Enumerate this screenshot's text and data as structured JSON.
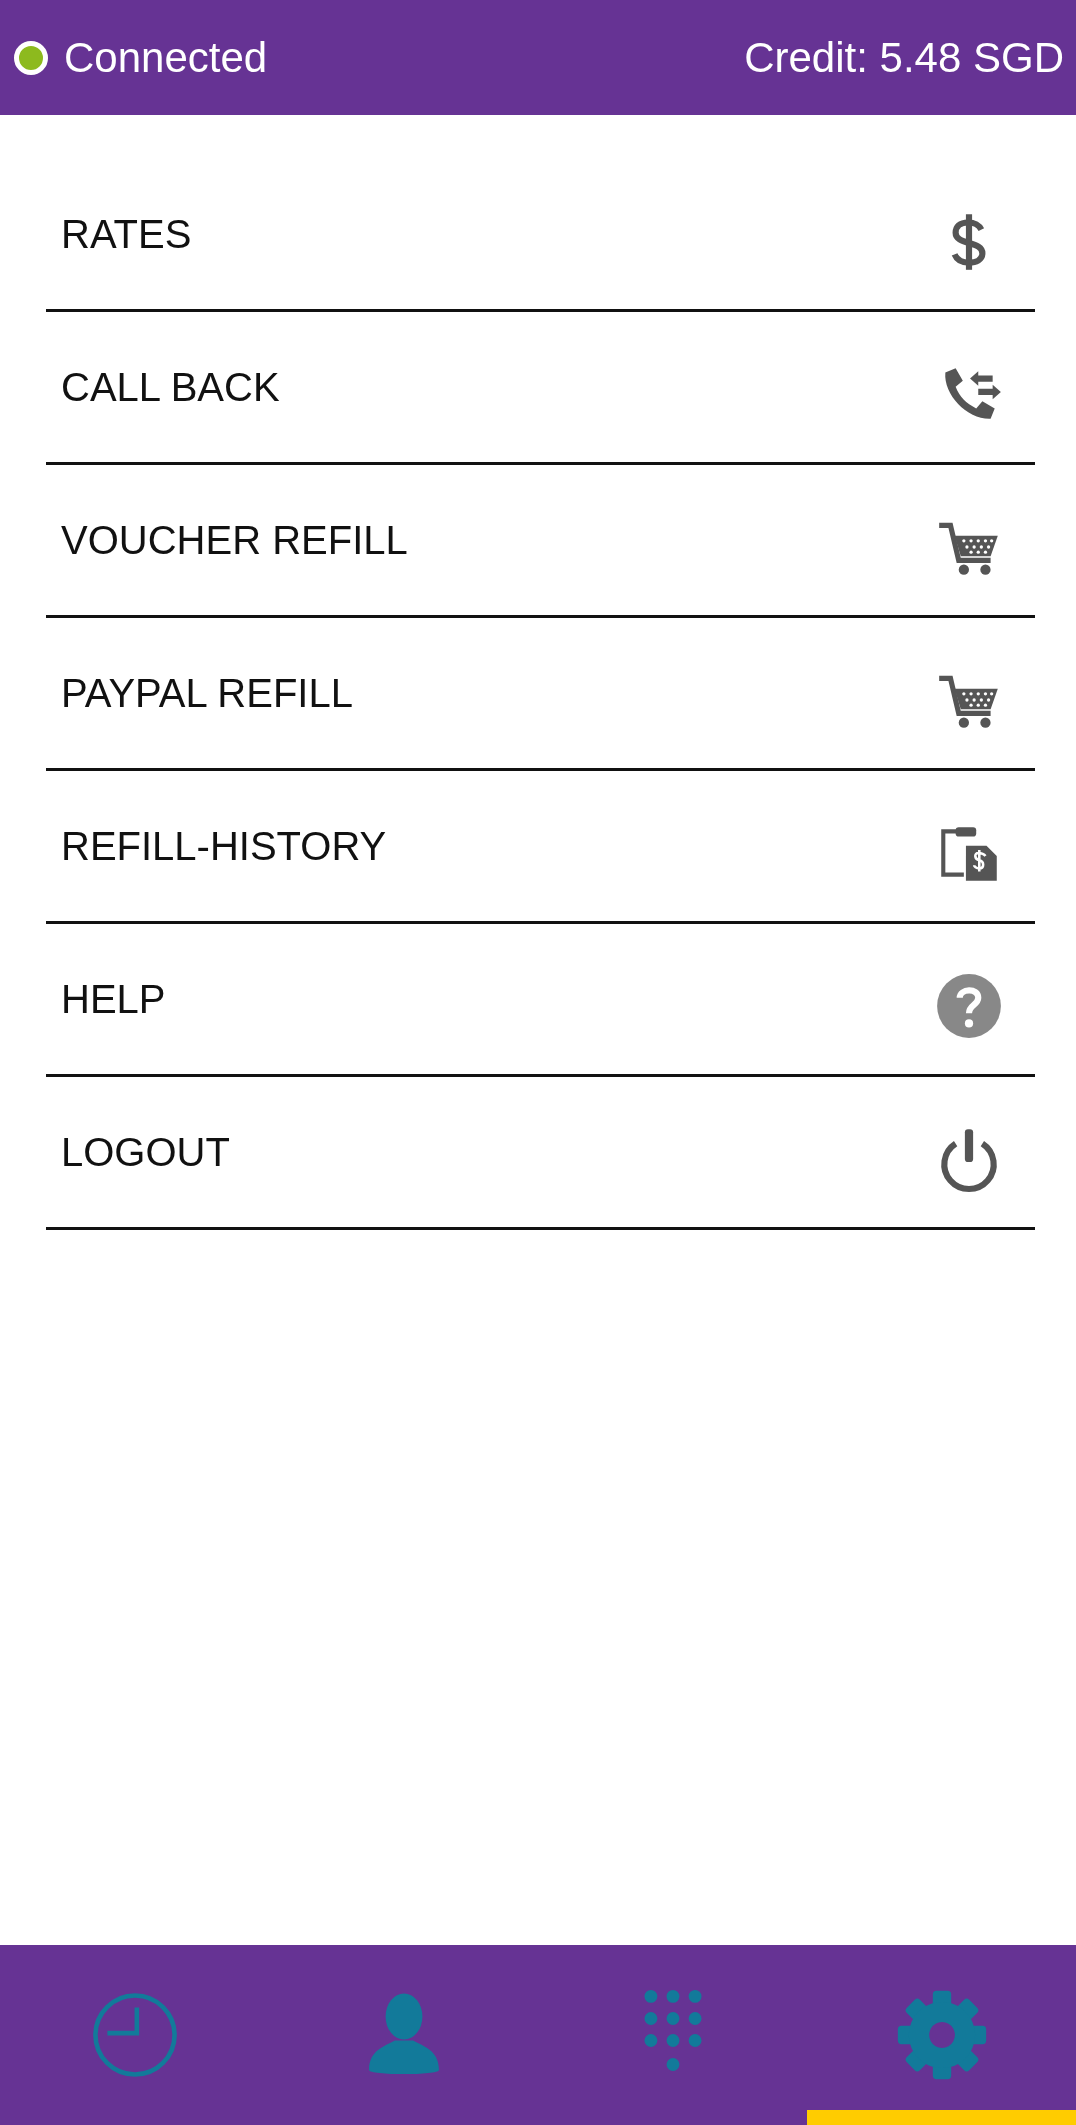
{
  "status_bar": {
    "status": "Connected",
    "connected": true,
    "credit": "Credit: 5.48 SGD"
  },
  "menu": [
    {
      "label": "RATES",
      "kind": "dollar"
    },
    {
      "label": "CALL BACK",
      "kind": "callback"
    },
    {
      "label": "VOUCHER REFILL",
      "kind": "cart"
    },
    {
      "label": "PAYPAL REFILL",
      "kind": "cart"
    },
    {
      "label": "REFILL-HISTORY",
      "kind": "history"
    },
    {
      "label": "HELP",
      "kind": "help"
    },
    {
      "label": "LOGOUT",
      "kind": "power"
    }
  ],
  "bottom_nav": [
    {
      "kind": "clock",
      "selected": false
    },
    {
      "kind": "contact",
      "selected": false
    },
    {
      "kind": "dialpad",
      "selected": false
    },
    {
      "kind": "settings",
      "selected": true
    }
  ]
}
